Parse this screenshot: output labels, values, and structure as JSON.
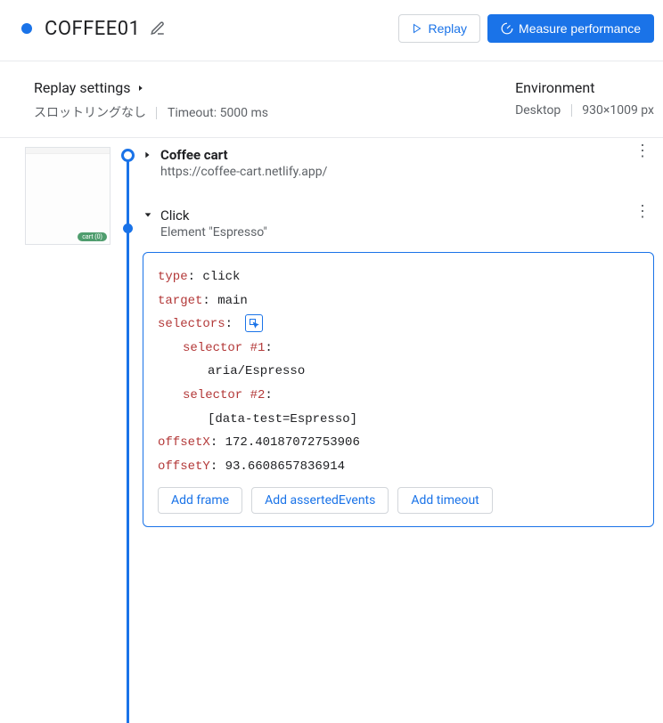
{
  "header": {
    "title": "COFFEE01",
    "replay_btn": "Replay",
    "measure_btn": "Measure performance"
  },
  "settings": {
    "title": "Replay settings",
    "throttling": "スロットリングなし",
    "timeout": "Timeout: 5000 ms",
    "env_title": "Environment",
    "env_device": "Desktop",
    "env_size": "930×1009 px"
  },
  "steps": [
    {
      "title": "Coffee cart",
      "subtitle": "https://coffee-cart.netlify.app/",
      "expanded": false
    },
    {
      "title": "Click",
      "subtitle": "Element \"Espresso\"",
      "expanded": true
    }
  ],
  "detail": {
    "type_k": "type",
    "type_v": ": click",
    "target_k": "target",
    "target_v": ": main",
    "selectors_k": "selectors",
    "selectors_v": ":",
    "sel1_k": "selector #1",
    "sel1_v": ":",
    "sel1_val": "aria/Espresso",
    "sel2_k": "selector #2",
    "sel2_v": ":",
    "sel2_val": "[data-test=Espresso]",
    "offx_k": "offsetX",
    "offx_v": ": 172.40187072753906",
    "offy_k": "offsetY",
    "offy_v": ": 93.6608657836914",
    "btn_frame": "Add frame",
    "btn_asserted": "Add assertedEvents",
    "btn_timeout": "Add timeout"
  },
  "thumb_cart": "cart (0)"
}
